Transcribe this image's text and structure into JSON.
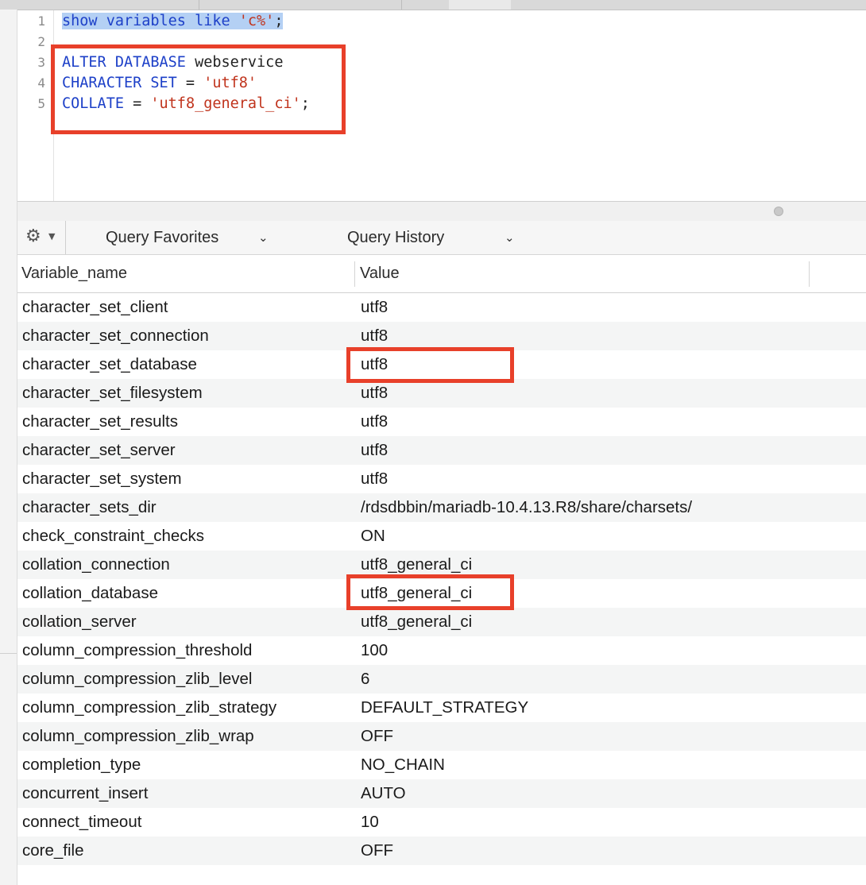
{
  "editor": {
    "line_numbers": [
      "1",
      "2",
      "3",
      "4",
      "5"
    ],
    "line1": {
      "kw": "show variables like ",
      "str": "'c%'",
      "end": ";"
    },
    "line3": {
      "kw": "ALTER DATABASE",
      "rest": " webservice"
    },
    "line4": {
      "kw": "CHARACTER SET",
      "eq": " = ",
      "str": "'utf8'"
    },
    "line5": {
      "kw": "COLLATE",
      "eq": " = ",
      "str": "'utf8_general_ci'",
      "end": ";"
    }
  },
  "toolbar": {
    "favorites_label": "Query Favorites",
    "history_label": "Query History"
  },
  "table": {
    "headers": [
      "Variable_name",
      "Value"
    ],
    "rows": [
      {
        "name": "character_set_client",
        "value": "utf8"
      },
      {
        "name": "character_set_connection",
        "value": "utf8"
      },
      {
        "name": "character_set_database",
        "value": "utf8"
      },
      {
        "name": "character_set_filesystem",
        "value": "utf8"
      },
      {
        "name": "character_set_results",
        "value": "utf8"
      },
      {
        "name": "character_set_server",
        "value": "utf8"
      },
      {
        "name": "character_set_system",
        "value": "utf8"
      },
      {
        "name": "character_sets_dir",
        "value": "/rdsdbbin/mariadb-10.4.13.R8/share/charsets/"
      },
      {
        "name": "check_constraint_checks",
        "value": "ON"
      },
      {
        "name": "collation_connection",
        "value": "utf8_general_ci"
      },
      {
        "name": "collation_database",
        "value": "utf8_general_ci"
      },
      {
        "name": "collation_server",
        "value": "utf8_general_ci"
      },
      {
        "name": "column_compression_threshold",
        "value": "100"
      },
      {
        "name": "column_compression_zlib_level",
        "value": "6"
      },
      {
        "name": "column_compression_zlib_strategy",
        "value": "DEFAULT_STRATEGY"
      },
      {
        "name": "column_compression_zlib_wrap",
        "value": "OFF"
      },
      {
        "name": "completion_type",
        "value": "NO_CHAIN"
      },
      {
        "name": "concurrent_insert",
        "value": "AUTO"
      },
      {
        "name": "connect_timeout",
        "value": "10"
      },
      {
        "name": "core_file",
        "value": "OFF"
      }
    ]
  },
  "colors": {
    "keyword": "#1d40c8",
    "string": "#c0341d",
    "selection": "#b4d0f4",
    "highlight_box": "#e8402a"
  },
  "icons": [
    "gear-icon",
    "chevron-down-icon"
  ]
}
